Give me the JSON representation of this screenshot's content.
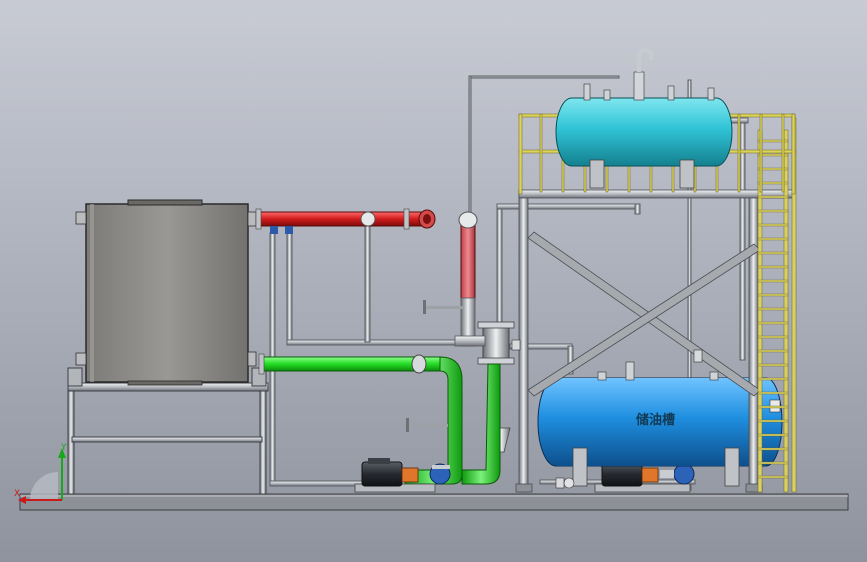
{
  "diagram": {
    "tank_label": "储油槽",
    "axis": {
      "y": "Y",
      "x": "X"
    }
  },
  "colors": {
    "background_top": "#c8cbd4",
    "background_bottom": "#8f939d",
    "hot_pipe": "#d11b1b",
    "return_pipe": "#22dd22",
    "tank_cyan": "#2fc4d6",
    "tank_blue": "#1f8fe0",
    "railing": "#e8e05a",
    "steel": "#9ea2a8",
    "furnace": "#8c8a86"
  },
  "icons": [
    "furnace-box",
    "pump-motor",
    "expansion-tank",
    "storage-tank",
    "ladder",
    "valve"
  ]
}
